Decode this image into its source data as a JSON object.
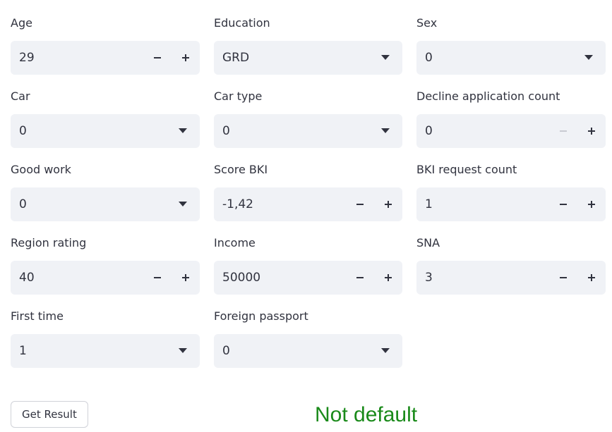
{
  "fields": [
    {
      "label": "Age",
      "value": "29",
      "kind": "number"
    },
    {
      "label": "Education",
      "value": "GRD",
      "kind": "select"
    },
    {
      "label": "Sex",
      "value": "0",
      "kind": "select"
    },
    {
      "label": "Car",
      "value": "0",
      "kind": "select"
    },
    {
      "label": "Car type",
      "value": "0",
      "kind": "select"
    },
    {
      "label": "Decline application count",
      "value": "0",
      "kind": "number",
      "minus_disabled": true
    },
    {
      "label": "Good work",
      "value": "0",
      "kind": "select"
    },
    {
      "label": "Score BKI",
      "value": "-1,42",
      "kind": "number"
    },
    {
      "label": "BKI request count",
      "value": "1",
      "kind": "number"
    },
    {
      "label": "Region rating",
      "value": "40",
      "kind": "number"
    },
    {
      "label": "Income",
      "value": "50000",
      "kind": "number"
    },
    {
      "label": "SNA",
      "value": "3",
      "kind": "number"
    },
    {
      "label": "First time",
      "value": "1",
      "kind": "select"
    },
    {
      "label": "Foreign passport",
      "value": "0",
      "kind": "select"
    }
  ],
  "button": {
    "label": "Get Result"
  },
  "result": {
    "text": "Not default",
    "color": "#1a8a1a"
  },
  "icons": {
    "minus": "minus-icon",
    "plus": "plus-icon",
    "caret": "chevron-down-icon"
  }
}
